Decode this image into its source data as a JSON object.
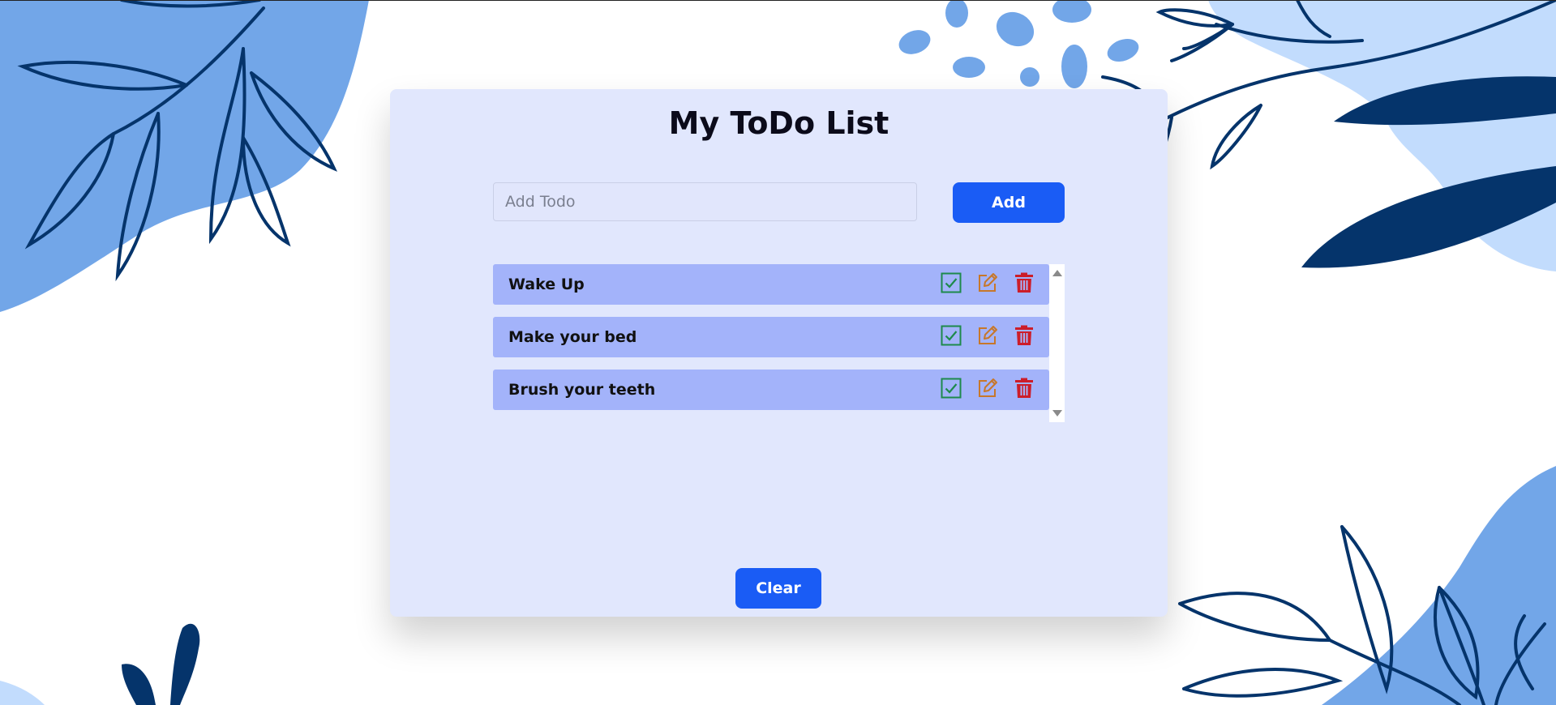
{
  "app": {
    "title": "My ToDo List"
  },
  "input": {
    "value": "",
    "placeholder": "Add Todo"
  },
  "buttons": {
    "add_label": "Add",
    "clear_label": "Clear"
  },
  "todos": [
    {
      "label": "Wake Up"
    },
    {
      "label": "Make your bed"
    },
    {
      "label": "Brush your teeth"
    }
  ],
  "icons": {
    "complete": "check-square-icon",
    "edit": "edit-pencil-icon",
    "delete": "trash-icon"
  },
  "colors": {
    "primary": "#1a5cf5",
    "card_bg": "#e1e7fd",
    "item_bg": "#a3b3fa",
    "complete_icon": "#1e8a4c",
    "edit_icon": "#c7772a",
    "delete_icon": "#cc1d2a",
    "leaf_dark": "#05346b",
    "blob_mid": "#72a6e8",
    "blob_light": "#c2dcfd"
  }
}
